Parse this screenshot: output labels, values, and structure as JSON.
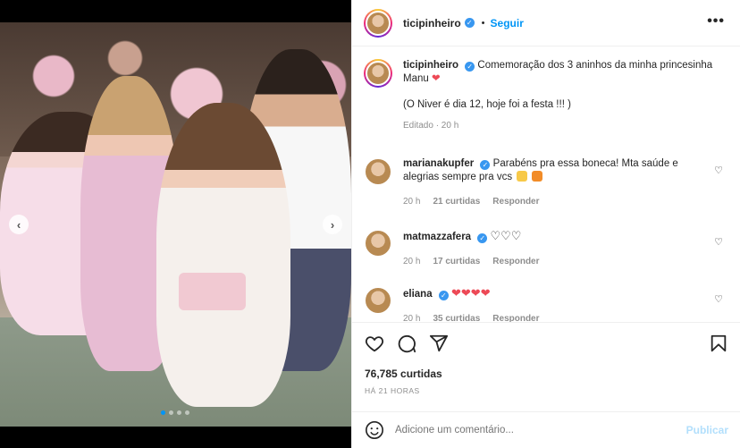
{
  "post": {
    "author": "ticipinheiro",
    "follow_label": "Seguir",
    "separator": "•",
    "more_label": "•••"
  },
  "caption": {
    "author": "ticipinheiro",
    "text_1": "Comemoração dos 3 aninhos da minha princesinha Manu",
    "text_2": "(O Niver é dia 12, hoje foi a festa !!! )",
    "meta": "Editado · 20 h"
  },
  "comments": [
    {
      "author": "marianakupfer",
      "text": "Parabéns pra essa boneca! Mta saúde e alegrias sempre pra vcs",
      "time": "20 h",
      "likes": "21 curtidas",
      "reply": "Responder"
    },
    {
      "author": "matmazzafera",
      "text": "",
      "time": "20 h",
      "likes": "17 curtidas",
      "reply": "Responder"
    },
    {
      "author": "eliana",
      "text": "",
      "time": "20 h",
      "likes": "35 curtidas",
      "reply": "Responder"
    }
  ],
  "stats": {
    "likes": "76,785 curtidas",
    "time_ago": "HÁ 21 HORAS"
  },
  "composer": {
    "placeholder": "Adicione um comentário...",
    "publish_label": "Publicar"
  },
  "carousel": {
    "slides": 4,
    "active_index": 0
  },
  "colors": {
    "accent": "#0095f6",
    "verified": "#3897f0",
    "heart_red": "#ed4956",
    "publish_disabled": "#b2dffc"
  },
  "icons": [
    "like-icon",
    "comment-icon",
    "share-icon",
    "bookmark-icon",
    "emoji-icon",
    "verified-icon",
    "more-icon"
  ]
}
